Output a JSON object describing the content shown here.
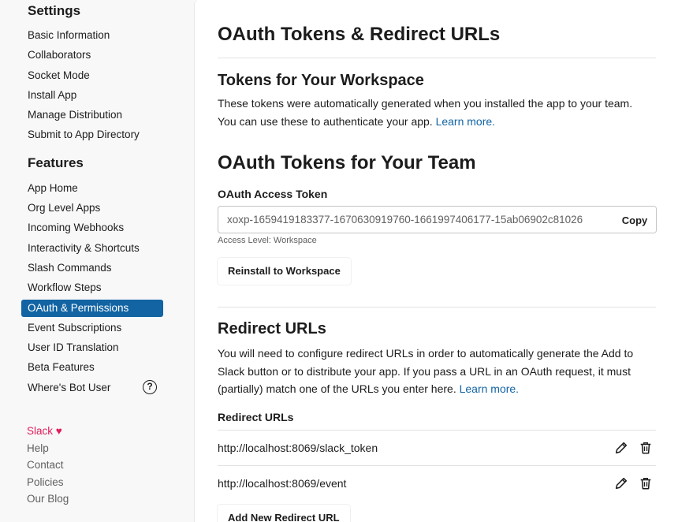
{
  "sidebar": {
    "settings_heading": "Settings",
    "settings_items": [
      {
        "label": "Basic Information"
      },
      {
        "label": "Collaborators"
      },
      {
        "label": "Socket Mode"
      },
      {
        "label": "Install App"
      },
      {
        "label": "Manage Distribution"
      },
      {
        "label": "Submit to App Directory"
      }
    ],
    "features_heading": "Features",
    "features_items": [
      {
        "label": "App Home"
      },
      {
        "label": "Org Level Apps"
      },
      {
        "label": "Incoming Webhooks"
      },
      {
        "label": "Interactivity & Shortcuts"
      },
      {
        "label": "Slash Commands"
      },
      {
        "label": "Workflow Steps"
      },
      {
        "label": "OAuth & Permissions",
        "active": true
      },
      {
        "label": "Event Subscriptions"
      },
      {
        "label": "User ID Translation"
      },
      {
        "label": "Beta Features"
      },
      {
        "label": "Where's Bot User"
      }
    ],
    "help_glyph": "?",
    "footer": {
      "brand": "Slack",
      "heart": "♥",
      "links": [
        {
          "label": "Help"
        },
        {
          "label": "Contact"
        },
        {
          "label": "Policies"
        },
        {
          "label": "Our Blog"
        }
      ]
    }
  },
  "main": {
    "title": "OAuth Tokens & Redirect URLs",
    "workspace_tokens": {
      "heading": "Tokens for Your Workspace",
      "description": "These tokens were automatically generated when you installed the app to your team. You can use these to authenticate your app. ",
      "link": "Learn more."
    },
    "team_tokens": {
      "heading": "OAuth Tokens for Your Team",
      "field_label": "OAuth Access Token",
      "token_value": "xoxp-1659419183377-1670630919760-1661997406177-15ab06902c81026",
      "copy_label": "Copy",
      "access_level": "Access Level: Workspace",
      "reinstall_label": "Reinstall to Workspace"
    },
    "redirect": {
      "heading": "Redirect URLs",
      "description": "You will need to configure redirect URLs in order to automatically generate the Add to Slack button or to distribute your app. If you pass a URL in an OAuth request, it must (partially) match one of the URLs you enter here. ",
      "link": "Learn more.",
      "list_label": "Redirect URLs",
      "urls": [
        {
          "url": "http://localhost:8069/slack_token"
        },
        {
          "url": "http://localhost:8069/event"
        }
      ],
      "add_label": "Add New Redirect URL"
    }
  },
  "colors": {
    "accent": "#1264a3",
    "brand": "#e01e5a"
  }
}
